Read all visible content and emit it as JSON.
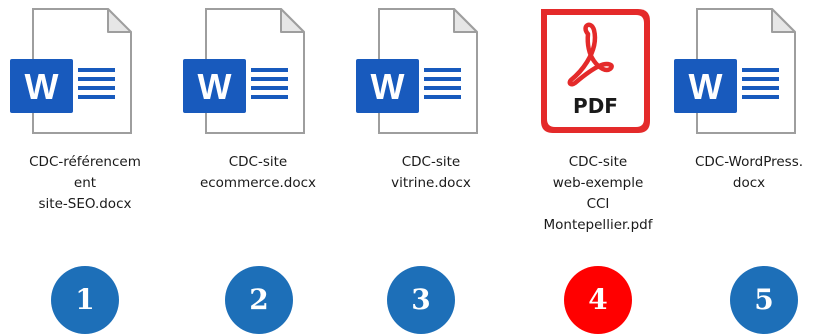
{
  "colors": {
    "word_blue": "#185abd",
    "pdf_red": "#e42a2a",
    "badge_blue": "#1d6fb8",
    "badge_red": "#ff0000"
  },
  "files": [
    {
      "type": "word",
      "icon": "word-document-icon",
      "label_lines": [
        "CDC-référencem",
        "ent",
        "site-SEO.docx"
      ],
      "number": "1"
    },
    {
      "type": "word",
      "icon": "word-document-icon",
      "label_lines": [
        "CDC-site",
        "ecommerce.docx"
      ],
      "number": "2"
    },
    {
      "type": "word",
      "icon": "word-document-icon",
      "label_lines": [
        "CDC-site",
        "vitrine.docx"
      ],
      "number": "3"
    },
    {
      "type": "pdf",
      "icon": "pdf-document-icon",
      "label_lines": [
        "CDC-site",
        "web-exemple",
        "CCI",
        "Montepellier.pdf"
      ],
      "number": "4",
      "pdf_text": "PDF"
    },
    {
      "type": "word",
      "icon": "word-document-icon",
      "label_lines": [
        "CDC-WordPress.",
        "docx"
      ],
      "number": "5"
    }
  ]
}
